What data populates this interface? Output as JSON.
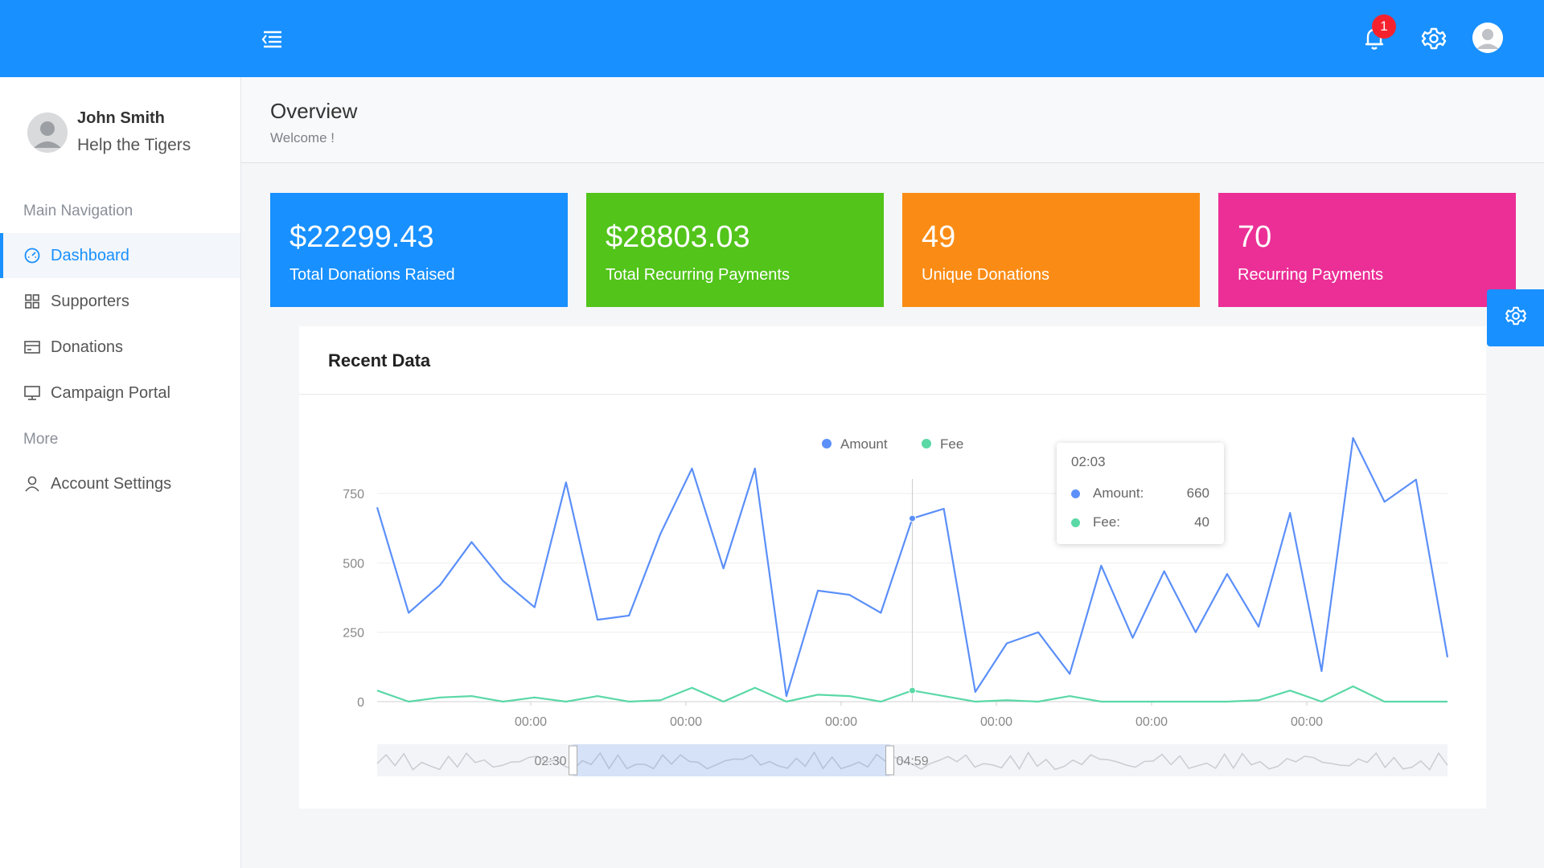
{
  "header": {
    "notification_count": "1"
  },
  "sidebar": {
    "user": {
      "name": "John Smith",
      "organization": "Help the Tigers"
    },
    "main_section": "Main Navigation",
    "items": [
      {
        "label": "Dashboard",
        "icon": "dashboard-icon",
        "active": true
      },
      {
        "label": "Supporters",
        "icon": "grid-icon"
      },
      {
        "label": "Donations",
        "icon": "card-icon"
      },
      {
        "label": "Campaign Portal",
        "icon": "monitor-icon"
      }
    ],
    "more_section": "More",
    "more_items": [
      {
        "label": "Account Settings",
        "icon": "user-icon"
      }
    ]
  },
  "page": {
    "title": "Overview",
    "subtitle": "Welcome !"
  },
  "stats": [
    {
      "value": "$22299.43",
      "label": "Total Donations Raised",
      "color": "#1890ff"
    },
    {
      "value": "$28803.03",
      "label": "Total Recurring Payments",
      "color": "#52c41a"
    },
    {
      "value": "49",
      "label": "Unique Donations",
      "color": "#fa8c16"
    },
    {
      "value": "70",
      "label": "Recurring Payments",
      "color": "#eb2f96"
    }
  ],
  "card": {
    "title": "Recent Data"
  },
  "tooltip": {
    "time": "02:03",
    "rows": [
      {
        "name": "Amount:",
        "value": "660",
        "color": "#5b8ff9"
      },
      {
        "name": "Fee:",
        "value": "40",
        "color": "#5ad8a6"
      }
    ]
  },
  "chart_data": {
    "type": "line",
    "series": [
      {
        "name": "Amount",
        "color": "#5b8ff9",
        "values": [
          700,
          320,
          420,
          575,
          435,
          340,
          790,
          295,
          310,
          605,
          840,
          480,
          840,
          20,
          400,
          385,
          320,
          660,
          695,
          35,
          210,
          250,
          100,
          490,
          230,
          470,
          250,
          460,
          270,
          680,
          110,
          950,
          720,
          800,
          160
        ]
      },
      {
        "name": "Fee",
        "color": "#5ad8a6",
        "values": [
          40,
          0,
          15,
          20,
          0,
          15,
          0,
          20,
          0,
          5,
          50,
          0,
          50,
          0,
          25,
          20,
          0,
          40,
          20,
          0,
          5,
          0,
          20,
          0,
          0,
          0,
          0,
          0,
          5,
          40,
          0,
          55,
          0,
          0,
          0
        ]
      }
    ],
    "x_tick_labels": [
      "00:00",
      "00:00",
      "00:00",
      "00:00",
      "00:00",
      "00:00"
    ],
    "y_ticks": [
      0,
      250,
      500,
      750
    ],
    "ylim": [
      0,
      950
    ],
    "legend_position": "top-center",
    "grid": true,
    "slider": {
      "start_label": "02:30",
      "end_label": "04:59",
      "start_fraction": 0.183,
      "end_fraction": 0.479
    }
  }
}
